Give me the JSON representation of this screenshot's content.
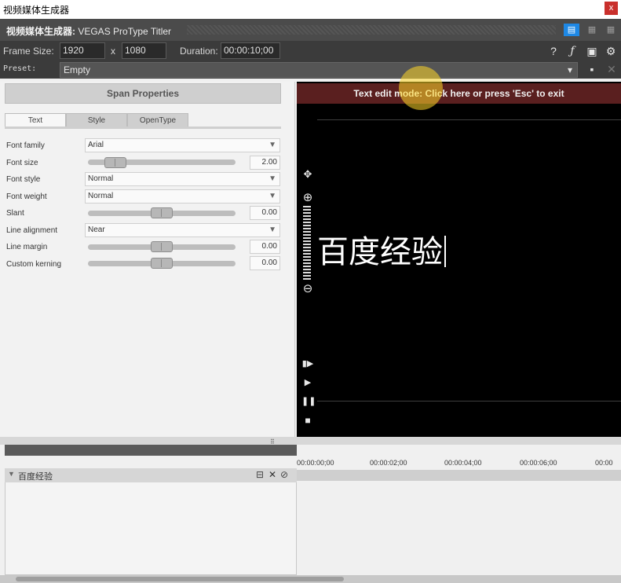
{
  "window": {
    "title": "视频媒体生成器",
    "close_glyph": "x"
  },
  "header": {
    "prefix": "视频媒体生成器:",
    "name": "VEGAS ProType Titler"
  },
  "frame": {
    "size_label": "Frame Size:",
    "width": "1920",
    "x_label": "x",
    "height": "1080",
    "duration_label": "Duration:",
    "duration": "00:00:10;00"
  },
  "preset": {
    "label": "Preset:",
    "value": "Empty"
  },
  "panel": {
    "title": "Span Properties",
    "tabs": [
      {
        "label": "Text"
      },
      {
        "label": "Style"
      },
      {
        "label": "OpenType"
      }
    ],
    "rows": {
      "font_family": {
        "label": "Font family",
        "value": "Arial"
      },
      "font_size": {
        "label": "Font size",
        "value": "2.00"
      },
      "font_style": {
        "label": "Font style",
        "value": "Normal"
      },
      "font_weight": {
        "label": "Font weight",
        "value": "Normal"
      },
      "slant": {
        "label": "Slant",
        "value": "0.00"
      },
      "line_alignment": {
        "label": "Line alignment",
        "value": "Near"
      },
      "line_margin": {
        "label": "Line margin",
        "value": "0.00"
      },
      "custom_kerning": {
        "label": "Custom kerning",
        "value": "0.00"
      }
    }
  },
  "preview": {
    "banner": "Text edit mode: Click here or press 'Esc' to exit",
    "text": "百度经验"
  },
  "timeline": {
    "track_name": "百度经验",
    "ticks": [
      "00:00:00;00",
      "00:00:02;00",
      "00:00:04;00",
      "00:00:06;00",
      "00:00"
    ]
  },
  "icons": [
    "help-icon",
    "fx-icon",
    "preview-window-icon",
    "gear-icon",
    "save-icon",
    "delete-icon",
    "move-icon",
    "zoom-in-icon",
    "zoom-out-icon",
    "step-icon",
    "play-icon",
    "pause-icon",
    "stop-icon"
  ]
}
